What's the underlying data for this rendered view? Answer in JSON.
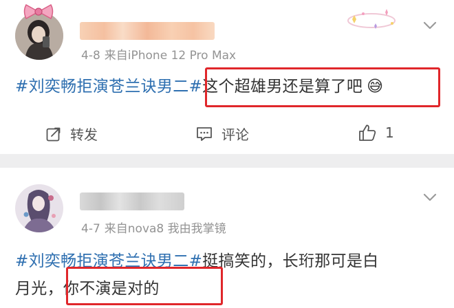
{
  "posts": [
    {
      "date": "4-8",
      "source": "来自iPhone 12 Pro Max",
      "topic": "#刘奕畅拒演苍兰诀男二#",
      "text": "这个超雄男还是算了吧",
      "emoji": "😅",
      "actions": {
        "repost": "转发",
        "comment": "评论",
        "like_count": "1"
      }
    },
    {
      "date": "4-7",
      "source": "来自nova8 我由我掌镜",
      "topic": "#刘奕畅拒演苍兰诀男二#",
      "text_line1": "挺搞笑的，长珩那可是白",
      "text_line2_a": "月光，",
      "text_line2_b": "你不演是对的"
    }
  ],
  "colors": {
    "topic_link": "#2e6fb0",
    "highlight_box": "#e0262a",
    "meta_text": "#939393",
    "divider": "#eeeeef"
  },
  "icons": [
    "avatar",
    "chevron-down-icon",
    "repost-icon",
    "comment-icon",
    "like-icon",
    "bow-sticker",
    "sparkle-sticker"
  ]
}
